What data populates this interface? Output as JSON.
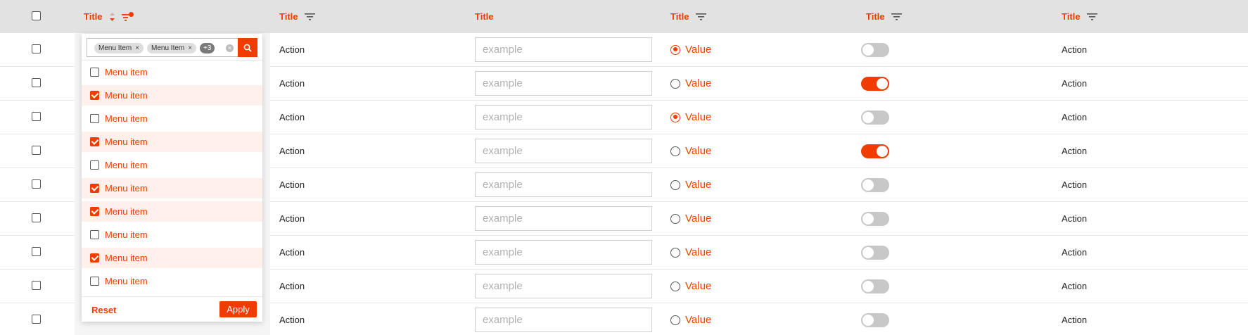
{
  "header": {
    "columns": [
      {
        "title": "Title"
      },
      {
        "title": "Title"
      },
      {
        "title": "Title"
      },
      {
        "title": "Title"
      },
      {
        "title": "Title"
      },
      {
        "title": "Title"
      }
    ]
  },
  "rows": [
    {
      "action_a": "Action",
      "input_placeholder": "example",
      "radio_label": "Value",
      "radio_selected": true,
      "toggle_on": false,
      "action_b": "Action"
    },
    {
      "action_a": "Action",
      "input_placeholder": "example",
      "radio_label": "Value",
      "radio_selected": false,
      "toggle_on": true,
      "action_b": "Action"
    },
    {
      "action_a": "Action",
      "input_placeholder": "example",
      "radio_label": "Value",
      "radio_selected": true,
      "toggle_on": false,
      "action_b": "Action"
    },
    {
      "action_a": "Action",
      "input_placeholder": "example",
      "radio_label": "Value",
      "radio_selected": false,
      "toggle_on": true,
      "action_b": "Action"
    },
    {
      "action_a": "Action",
      "input_placeholder": "example",
      "radio_label": "Value",
      "radio_selected": false,
      "toggle_on": false,
      "action_b": "Action"
    },
    {
      "action_a": "Action",
      "input_placeholder": "example",
      "radio_label": "Value",
      "radio_selected": false,
      "toggle_on": false,
      "action_b": "Action"
    },
    {
      "action_a": "Action",
      "input_placeholder": "example",
      "radio_label": "Value",
      "radio_selected": false,
      "toggle_on": false,
      "action_b": "Action"
    },
    {
      "action_a": "Action",
      "input_placeholder": "example",
      "radio_label": "Value",
      "radio_selected": false,
      "toggle_on": false,
      "action_b": "Action"
    },
    {
      "action_a": "Action",
      "input_placeholder": "example",
      "radio_label": "Value",
      "radio_selected": false,
      "toggle_on": false,
      "action_b": "Action"
    }
  ],
  "filter_dropdown": {
    "chips": [
      {
        "label": "Menu Item"
      },
      {
        "label": "Menu Item"
      }
    ],
    "more_count": "+3",
    "items": [
      {
        "label": "Menu item",
        "checked": false
      },
      {
        "label": "Menu item",
        "checked": true
      },
      {
        "label": "Menu item",
        "checked": false
      },
      {
        "label": "Menu item",
        "checked": true
      },
      {
        "label": "Menu item",
        "checked": false
      },
      {
        "label": "Menu item",
        "checked": true
      },
      {
        "label": "Menu item",
        "checked": true
      },
      {
        "label": "Menu item",
        "checked": false
      },
      {
        "label": "Menu item",
        "checked": true
      },
      {
        "label": "Menu item",
        "checked": false
      }
    ],
    "reset_label": "Reset",
    "apply_label": "Apply"
  },
  "colors": {
    "accent": "#f03c00",
    "header_bg": "#e2e2e2",
    "selected_row_bg": "#fff0ec",
    "toggle_off": "#c8c8c8"
  },
  "icons": {
    "filter": "filter-icon",
    "sort": "sort-icon",
    "search": "search-icon",
    "clear": "clear-icon"
  }
}
